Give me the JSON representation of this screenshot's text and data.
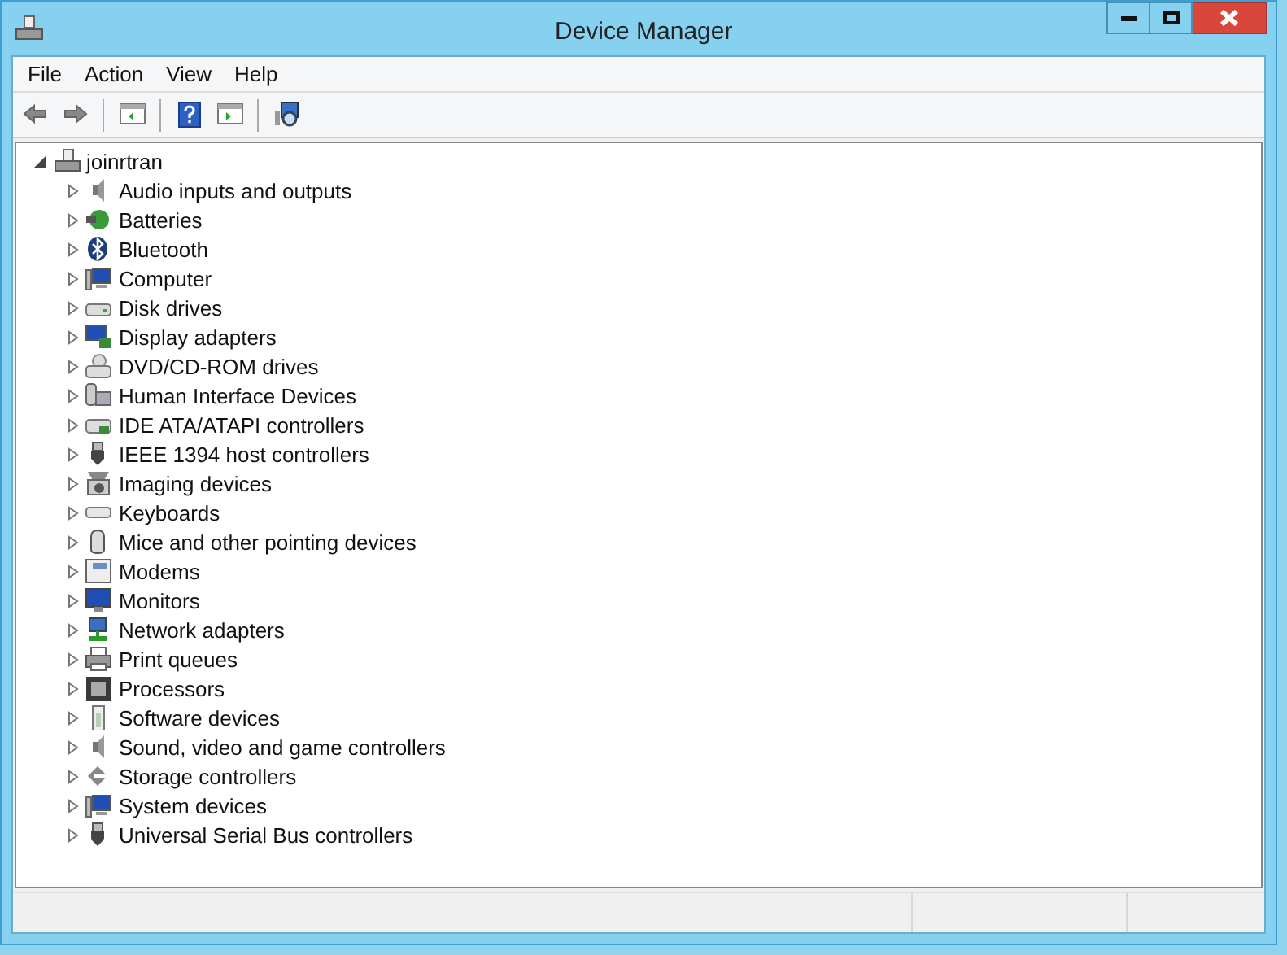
{
  "window": {
    "title": "Device Manager"
  },
  "menu": [
    "File",
    "Action",
    "View",
    "Help"
  ],
  "toolbar": [
    {
      "kind": "back"
    },
    {
      "kind": "forward"
    },
    {
      "kind": "sep"
    },
    {
      "kind": "pane"
    },
    {
      "kind": "sep"
    },
    {
      "kind": "help"
    },
    {
      "kind": "pane2"
    },
    {
      "kind": "sep"
    },
    {
      "kind": "scan"
    }
  ],
  "tree": {
    "label": "joinrtran",
    "expanded": true,
    "children": [
      {
        "label": "Audio inputs and outputs",
        "kind": "speaker",
        "expanded": false
      },
      {
        "label": "Batteries",
        "kind": "battery",
        "expanded": false
      },
      {
        "label": "Bluetooth",
        "kind": "bluetooth",
        "expanded": false
      },
      {
        "label": "Computer",
        "kind": "computer",
        "expanded": false
      },
      {
        "label": "Disk drives",
        "kind": "drive",
        "expanded": false
      },
      {
        "label": "Display adapters",
        "kind": "display",
        "expanded": false
      },
      {
        "label": "DVD/CD-ROM drives",
        "kind": "dvd",
        "expanded": false
      },
      {
        "label": "Human Interface Devices",
        "kind": "hid",
        "expanded": false
      },
      {
        "label": "IDE ATA/ATAPI controllers",
        "kind": "ide",
        "expanded": false
      },
      {
        "label": "IEEE 1394 host controllers",
        "kind": "plug",
        "expanded": false
      },
      {
        "label": "Imaging devices",
        "kind": "camera",
        "expanded": false
      },
      {
        "label": "Keyboards",
        "kind": "keyboard",
        "expanded": false
      },
      {
        "label": "Mice and other pointing devices",
        "kind": "mouse",
        "expanded": false
      },
      {
        "label": "Modems",
        "kind": "modem",
        "expanded": false
      },
      {
        "label": "Monitors",
        "kind": "monitor",
        "expanded": false
      },
      {
        "label": "Network adapters",
        "kind": "network",
        "expanded": false
      },
      {
        "label": "Print queues",
        "kind": "printer",
        "expanded": false
      },
      {
        "label": "Processors",
        "kind": "chip",
        "expanded": false
      },
      {
        "label": "Software devices",
        "kind": "software",
        "expanded": false
      },
      {
        "label": "Sound, video and game controllers",
        "kind": "speaker",
        "expanded": false
      },
      {
        "label": "Storage controllers",
        "kind": "storage",
        "expanded": false
      },
      {
        "label": "System devices",
        "kind": "computer",
        "expanded": false
      },
      {
        "label": "Universal Serial Bus controllers",
        "kind": "plug",
        "expanded": false
      }
    ]
  }
}
